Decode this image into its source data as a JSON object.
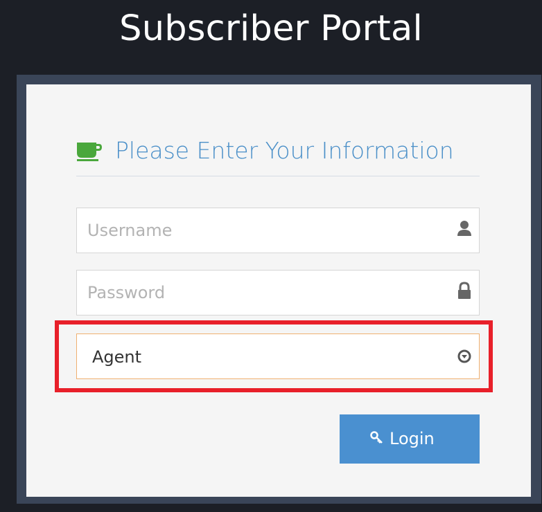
{
  "header": {
    "title": "Subscriber Portal"
  },
  "form": {
    "heading": "Please Enter Your Information",
    "heading_icon": "coffee-cup-icon",
    "username": {
      "placeholder": "Username",
      "value": "",
      "icon": "user-icon"
    },
    "password": {
      "placeholder": "Password",
      "value": "",
      "icon": "lock-icon"
    },
    "role": {
      "selected": "Agent",
      "icon": "select-indicator-icon"
    },
    "login_button": {
      "label": "Login",
      "icon": "key-icon"
    }
  },
  "colors": {
    "background": "#1c1f26",
    "card": "#f5f5f5",
    "accent": "#4a8fc8",
    "button": "#4a90d0",
    "cup": "#4aa73c",
    "highlight": "#e8202a",
    "focus_border": "#f0b070"
  }
}
